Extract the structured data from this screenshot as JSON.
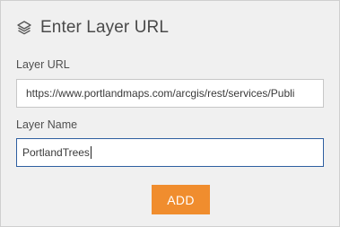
{
  "header": {
    "title": "Enter Layer URL",
    "icon": "layers-icon"
  },
  "form": {
    "url_label": "Layer URL",
    "url_value": "https://www.portlandmaps.com/arcgis/rest/services/Publi",
    "name_label": "Layer Name",
    "name_value": "PortlandTrees"
  },
  "actions": {
    "add_label": "ADD"
  },
  "colors": {
    "accent": "#f08d2e",
    "focus_border": "#2e5fa0",
    "background": "#f0f0f0"
  }
}
